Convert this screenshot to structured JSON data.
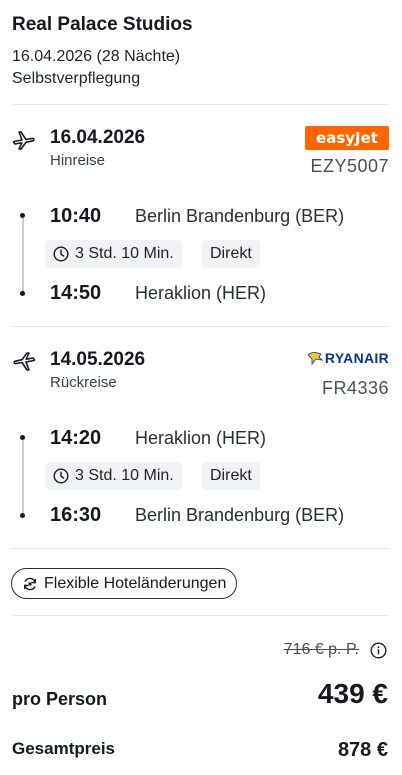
{
  "hotel": {
    "name": "Real Palace Studios",
    "dates": "16.04.2026 (28 Nächte)",
    "board": "Selbstverpflegung"
  },
  "outbound": {
    "date": "16.04.2026",
    "direction": "Hinreise",
    "airline_logo": "easyJet",
    "flight_number": "EZY5007",
    "departure_time": "10:40",
    "departure_airport": "Berlin Brandenburg (BER)",
    "duration": "3 Std. 10 Min.",
    "stops": "Direkt",
    "arrival_time": "14:50",
    "arrival_airport": "Heraklion (HER)"
  },
  "inbound": {
    "date": "14.05.2026",
    "direction": "Rückreise",
    "airline_logo": "RYANAIR",
    "flight_number": "FR4336",
    "departure_time": "14:20",
    "departure_airport": "Heraklion (HER)",
    "duration": "3 Std. 10 Min.",
    "stops": "Direkt",
    "arrival_time": "16:30",
    "arrival_airport": "Berlin Brandenburg (BER)"
  },
  "flex_button": {
    "label": "Flexible Hoteländerungen"
  },
  "price": {
    "old_per_person": "716 € p. P.",
    "per_person_label": "pro Person",
    "per_person_value": "439 €",
    "total_label": "Gesamtpreis",
    "total_value": "878 €"
  },
  "colors": {
    "easyjet": "#ff6600",
    "ryanair": "#073590",
    "ryanair_harp": "#f1c933",
    "divider": "#e4e6ea",
    "chip_bg": "#f1f2f4"
  },
  "icons": {
    "departure": "plane-takeoff-icon",
    "return": "plane-landing-icon",
    "clock": "clock-icon",
    "flex": "refresh-icon",
    "info": "info-icon"
  }
}
